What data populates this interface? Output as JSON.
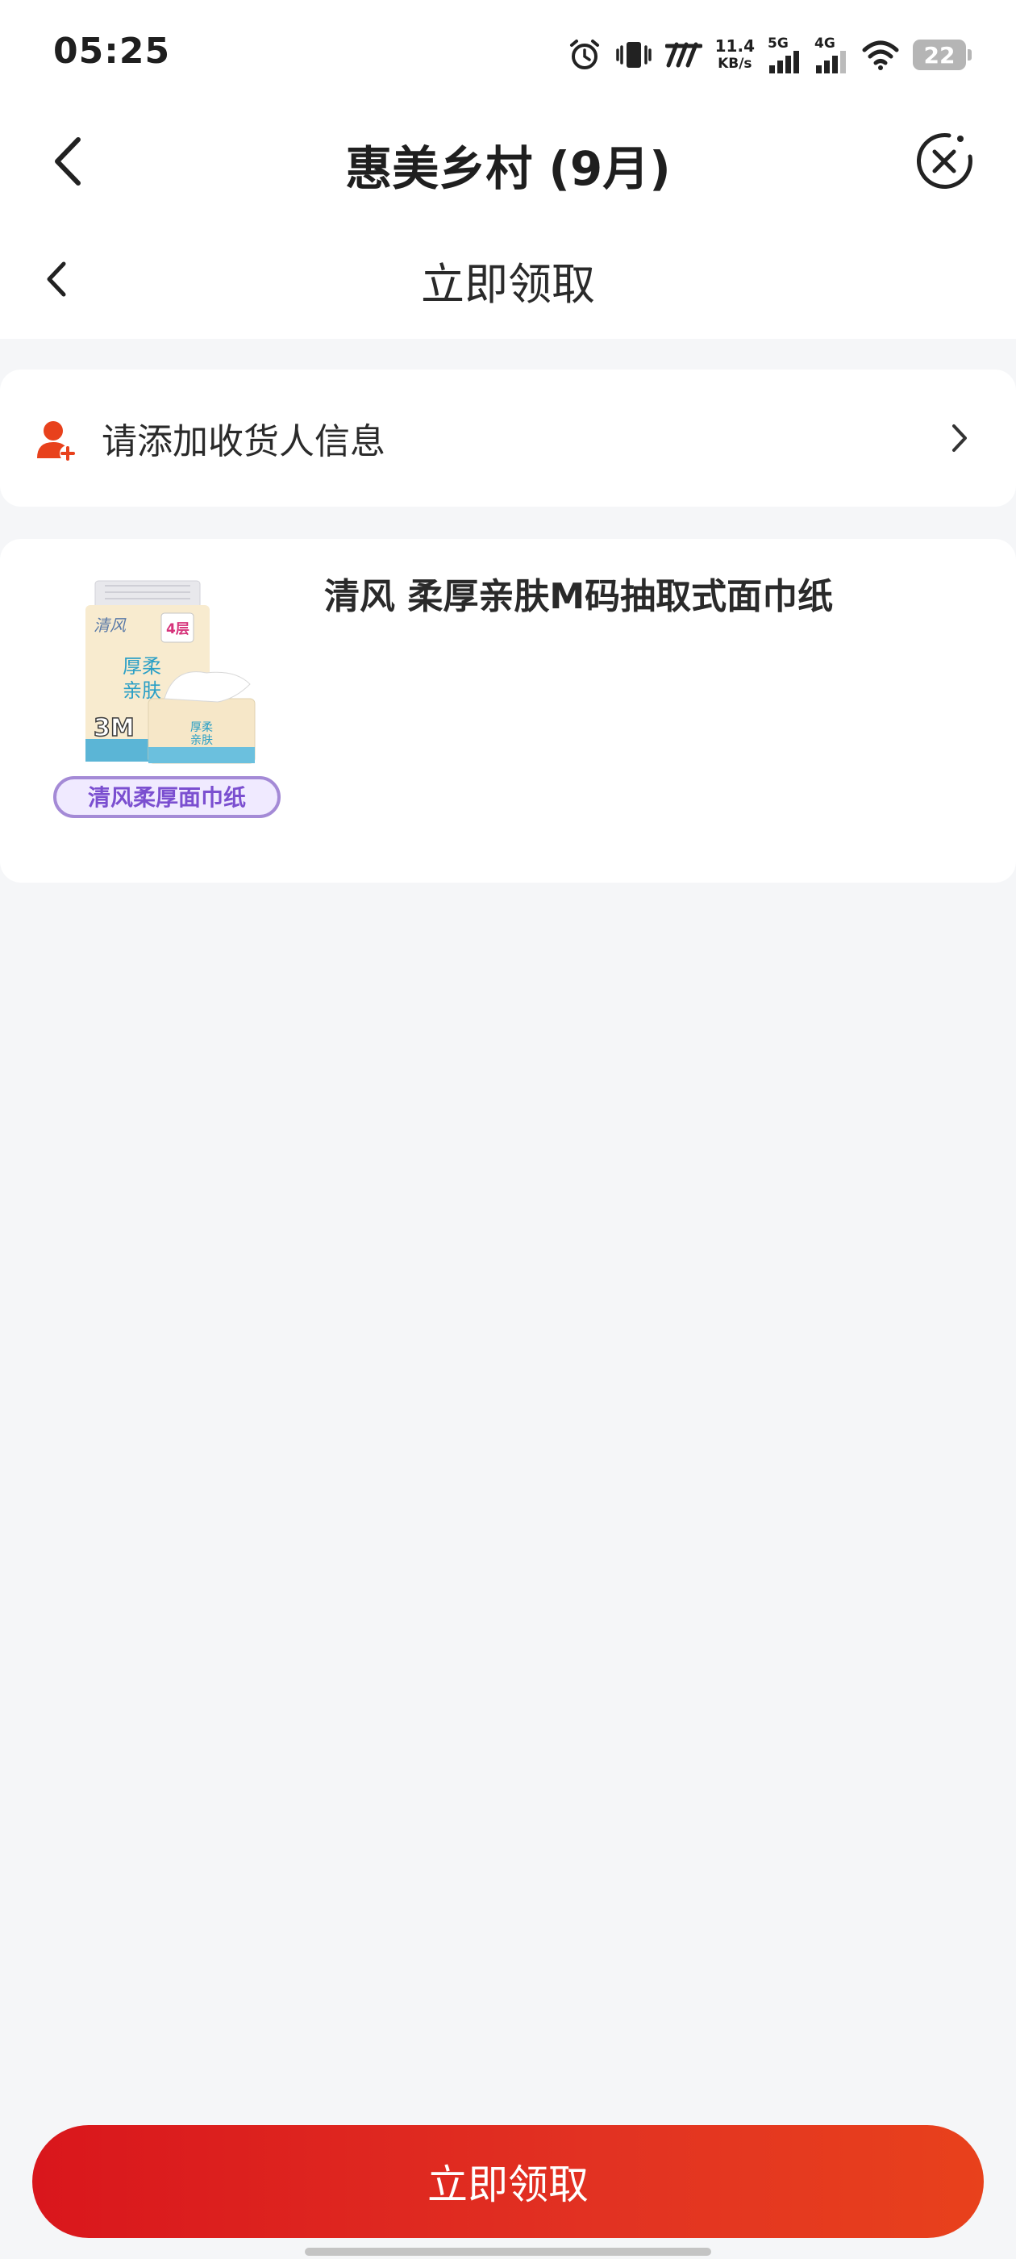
{
  "status_bar": {
    "time": "05:25",
    "net_speed_value": "11.4",
    "net_speed_unit": "KB/s",
    "signal_1_label": "5G",
    "signal_2_label": "4G",
    "battery_level": "22"
  },
  "nav": {
    "title": "惠美乡村 (9月)"
  },
  "sub_nav": {
    "title": "立即领取"
  },
  "address": {
    "prompt": "请添加收货人信息",
    "icon": "user-add-icon",
    "accent": "#e8411c"
  },
  "product": {
    "name": "清风 柔厚亲肤M码抽取式面巾纸",
    "image_badge": "清风柔厚面巾纸",
    "image_pack_text_1": "厚柔",
    "image_pack_text_2": "亲肤",
    "image_size_text": "3M",
    "image_corner_text": "4层"
  },
  "footer": {
    "claim_button_label": "立即领取",
    "button_color": "#d9161c"
  }
}
